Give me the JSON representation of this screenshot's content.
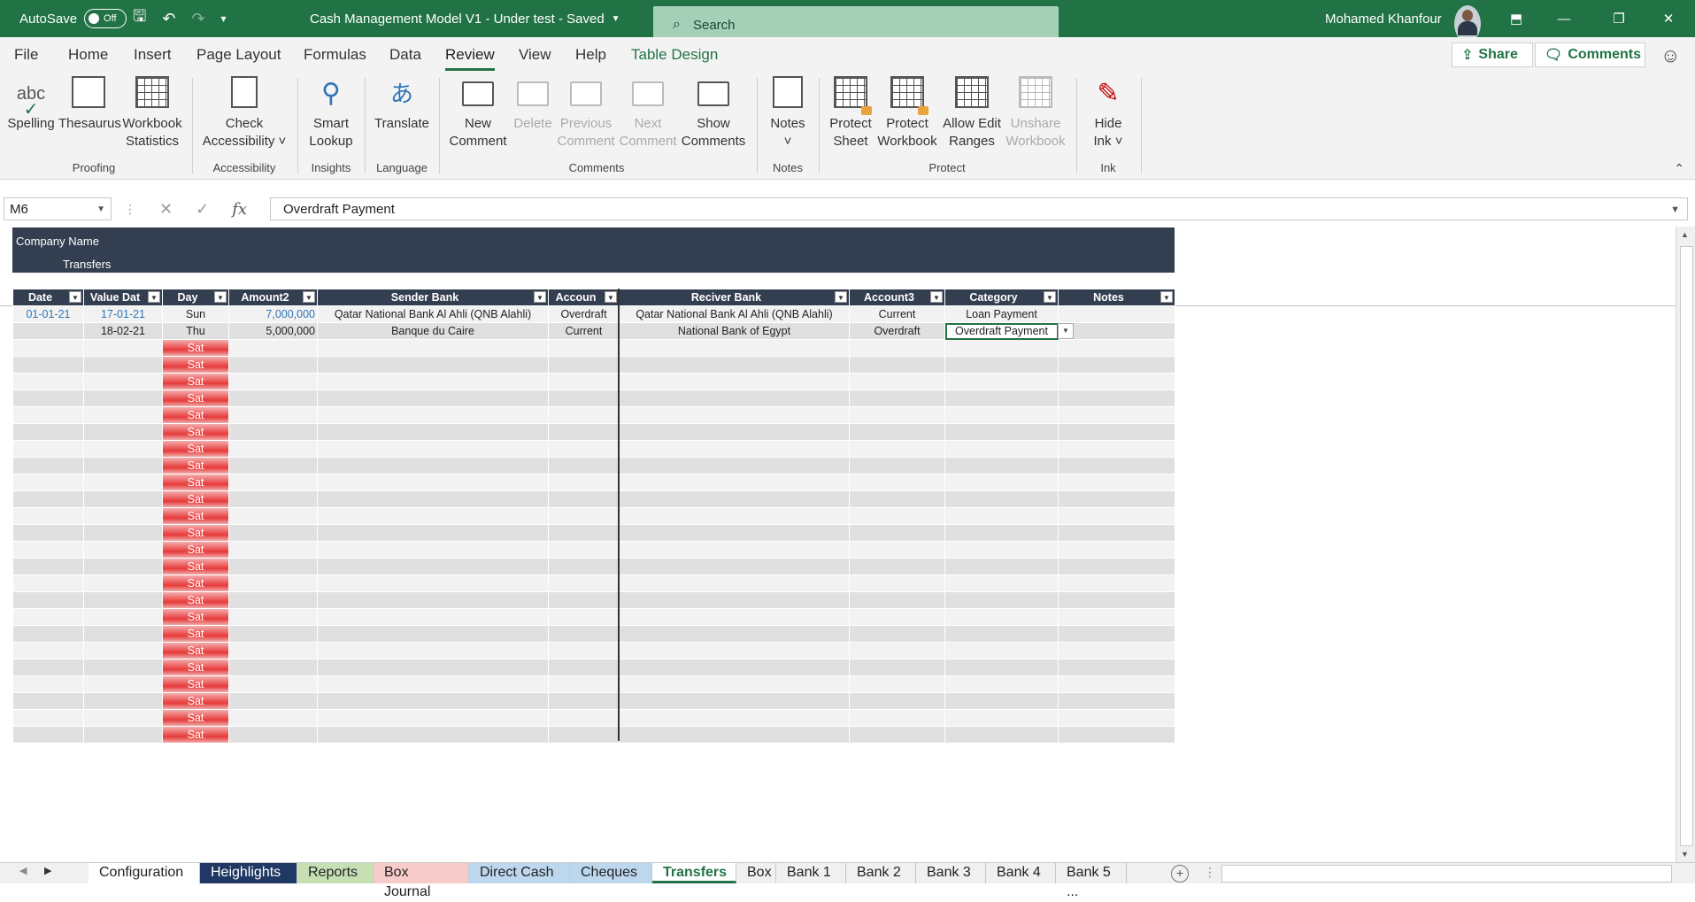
{
  "titlebar": {
    "autosave_label": "AutoSave",
    "autosave_state": "Off",
    "doc_title": "Cash Management Model V1 - Under test  -  Saved",
    "search_placeholder": "Search",
    "user_name": "Mohamed Khanfour"
  },
  "ribbon_tabs": [
    "File",
    "Home",
    "Insert",
    "Page Layout",
    "Formulas",
    "Data",
    "Review",
    "View",
    "Help",
    "Table Design"
  ],
  "active_tab": "Review",
  "share_label": "Share",
  "comments_label": "Comments",
  "ribbon": {
    "spelling": "Spelling",
    "thesaurus": "Thesaurus",
    "workbook_stats_1": "Workbook",
    "workbook_stats_2": "Statistics",
    "group_proofing": "Proofing",
    "check_access_1": "Check",
    "check_access_2": "Accessibility",
    "group_accessibility": "Accessibility",
    "smart_lookup_1": "Smart",
    "smart_lookup_2": "Lookup",
    "group_insights": "Insights",
    "translate": "Translate",
    "group_language": "Language",
    "new_comment_1": "New",
    "new_comment_2": "Comment",
    "delete_comment": "Delete",
    "prev_comment_1": "Previous",
    "prev_comment_2": "Comment",
    "next_comment_1": "Next",
    "next_comment_2": "Comment",
    "show_comments_1": "Show",
    "show_comments_2": "Comments",
    "group_comments": "Comments",
    "notes": "Notes",
    "group_notes": "Notes",
    "protect_sheet_1": "Protect",
    "protect_sheet_2": "Sheet",
    "protect_wb_1": "Protect",
    "protect_wb_2": "Workbook",
    "allow_edit_1": "Allow Edit",
    "allow_edit_2": "Ranges",
    "unshare_1": "Unshare",
    "unshare_2": "Workbook",
    "group_protect": "Protect",
    "hide_ink_1": "Hide",
    "hide_ink_2": "Ink",
    "group_ink": "Ink"
  },
  "formula_bar": {
    "name_box": "M6",
    "formula": "Overdraft Payment"
  },
  "sheet": {
    "company_name": "Company Name",
    "subtitle": "Transfers",
    "headers": [
      "Date",
      "Value Dat",
      "Day",
      "Amount2",
      "Sender Bank",
      "Accoun",
      "Reciver Bank",
      "Account3",
      "Category",
      "Notes"
    ],
    "rows": [
      [
        "01-01-21",
        "17-01-21",
        "Sun",
        "7,000,000",
        "Qatar National Bank Al Ahli (QNB Alahli)",
        "Overdraft",
        "Qatar National Bank Al Ahli (QNB Alahli)",
        "Current",
        "Loan Payment",
        ""
      ],
      [
        "",
        "18-02-21",
        "Thu",
        "5,000,000",
        "Banque du Caire",
        "Current",
        "National Bank of Egypt",
        "Overdraft",
        "Overdraft Payment",
        ""
      ]
    ],
    "empty_day_label": "Sat",
    "empty_row_count": 24
  },
  "sheet_tabs": [
    {
      "label": "Configuration",
      "color": "#ffffff",
      "text": "#222222"
    },
    {
      "label": "Heighlights",
      "color": "#1f3864",
      "text": "#ffffff"
    },
    {
      "label": "Reports",
      "color": "#c6e0b4",
      "text": "#222222"
    },
    {
      "label": "Box Journal",
      "color": "#f8cbcb",
      "text": "#222222"
    },
    {
      "label": "Direct Cash",
      "color": "#bdd7ee",
      "text": "#222222"
    },
    {
      "label": "Cheques",
      "color": "#bdd7ee",
      "text": "#222222"
    },
    {
      "label": "Transfers",
      "color": "#ffffff",
      "text": "#217346"
    },
    {
      "label": "Box",
      "color": "#f0f0f0",
      "text": "#222222"
    },
    {
      "label": "Bank 1",
      "color": "#f0f0f0",
      "text": "#222222"
    },
    {
      "label": "Bank 2",
      "color": "#f0f0f0",
      "text": "#222222"
    },
    {
      "label": "Bank 3",
      "color": "#f0f0f0",
      "text": "#222222"
    },
    {
      "label": "Bank 4",
      "color": "#f0f0f0",
      "text": "#222222"
    },
    {
      "label": "Bank 5 ...",
      "color": "#f0f0f0",
      "text": "#222222"
    }
  ],
  "active_sheet": "Transfers",
  "colors": {
    "excel_green": "#217346",
    "table_header": "#333f50",
    "weekend_red": "#e73a3a"
  }
}
